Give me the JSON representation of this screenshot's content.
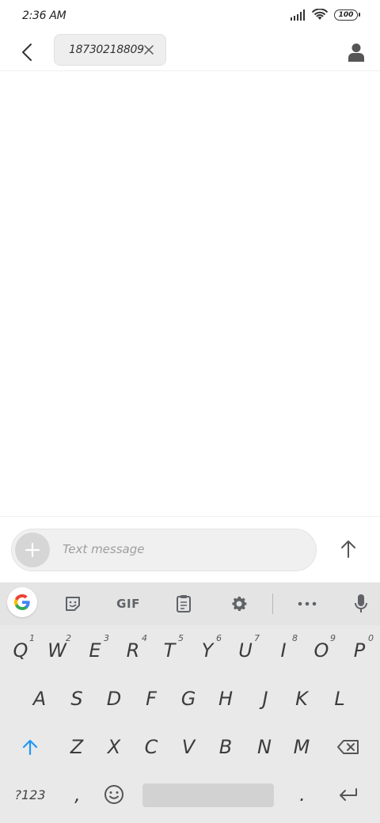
{
  "status_bar": {
    "time": "2:36 AM",
    "battery": "100",
    "icons": [
      "signal-icon",
      "wifi-icon",
      "battery-icon"
    ]
  },
  "header": {
    "recipient": "18730218809",
    "icons": [
      "back-arrow-icon",
      "close-icon",
      "contact-icon"
    ]
  },
  "compose": {
    "placeholder": "Text message",
    "icons": [
      "plus-icon",
      "send-arrow-icon"
    ]
  },
  "keyboard": {
    "toolbar": {
      "gif_label": "GIF",
      "icons": [
        "google-icon",
        "sticker-icon",
        "clipboard-icon",
        "gear-icon",
        "more-icon",
        "microphone-icon"
      ]
    },
    "row1": [
      {
        "key": "Q",
        "hint": "1"
      },
      {
        "key": "W",
        "hint": "2"
      },
      {
        "key": "E",
        "hint": "3"
      },
      {
        "key": "R",
        "hint": "4"
      },
      {
        "key": "T",
        "hint": "5"
      },
      {
        "key": "Y",
        "hint": "6"
      },
      {
        "key": "U",
        "hint": "7"
      },
      {
        "key": "I",
        "hint": "8"
      },
      {
        "key": "O",
        "hint": "9"
      },
      {
        "key": "P",
        "hint": "0"
      }
    ],
    "row2": [
      "A",
      "S",
      "D",
      "F",
      "G",
      "H",
      "J",
      "K",
      "L"
    ],
    "row3": [
      "Z",
      "X",
      "C",
      "V",
      "B",
      "N",
      "M"
    ],
    "row4": {
      "symbols": "?123",
      "comma": ",",
      "period": "."
    },
    "accent_color": "#2196f3",
    "icons": [
      "shift-icon",
      "backspace-icon",
      "emoji-icon",
      "enter-icon"
    ]
  }
}
